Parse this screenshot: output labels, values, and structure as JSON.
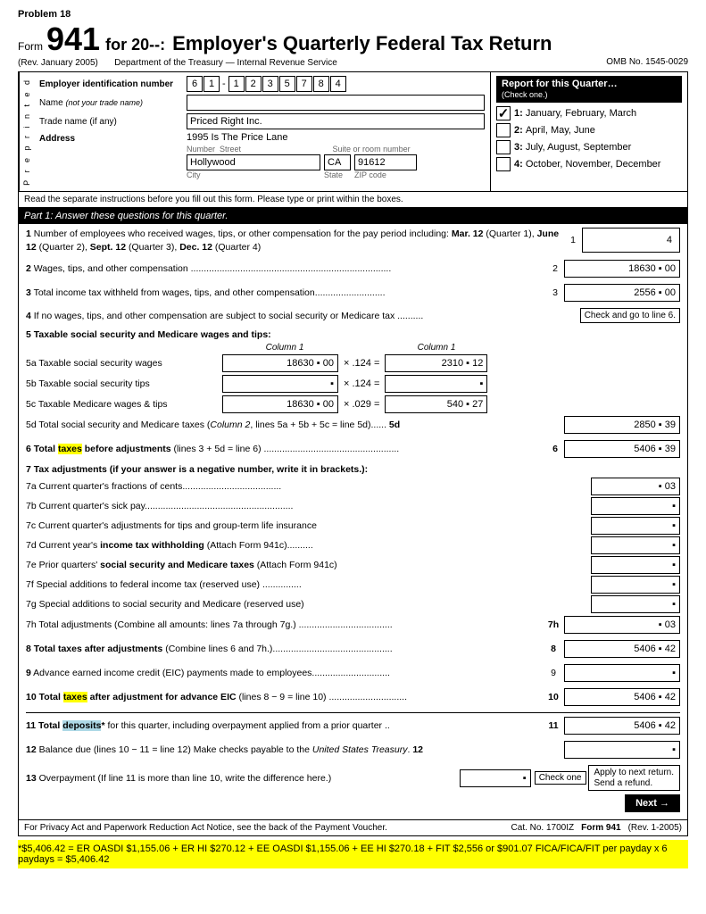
{
  "problem": {
    "label": "Problem 18"
  },
  "header": {
    "form_label": "Form",
    "form_number": "941",
    "for_text": "for 20--:",
    "title": "Employer's Quarterly Federal Tax Return",
    "rev": "(Rev. January 2005)",
    "dept": "Department of the Treasury — Internal Revenue Service",
    "omb": "OMB No. 1545-0029"
  },
  "employer": {
    "ein_label": "Employer identification number",
    "ein_digits": [
      "6",
      "1",
      "1",
      "2",
      "3",
      "5",
      "7",
      "8",
      "4"
    ],
    "name_label": "Name",
    "name_sublabel": "(not your trade name)",
    "name_value": "",
    "trade_label": "Trade name (if any)",
    "trade_value": "Priced Right Inc.",
    "address_label": "Address",
    "address_line1": "1995 Is The Price Lane",
    "number_label": "Number",
    "street_label": "Street",
    "suite_label": "Suite or room number",
    "city_value": "Hollywood",
    "state_value": "CA",
    "zip_value": "91612",
    "city_label": "City",
    "state_label": "State",
    "zip_label": "ZIP code"
  },
  "quarter": {
    "title": "Report for this Quarter…",
    "subtitle": "(Check one.)",
    "options": [
      {
        "num": "1",
        "label": "January, February, March",
        "checked": true
      },
      {
        "num": "2",
        "label": "April, May, June",
        "checked": false
      },
      {
        "num": "3",
        "label": "July, August, September",
        "checked": false
      },
      {
        "num": "4",
        "label": "October, November, December",
        "checked": false
      }
    ]
  },
  "preprinted": "P r e p r i n t e d",
  "instructions": "Read the separate instructions before you fill out this form. Please type or print within the boxes.",
  "part1": {
    "header": "Part 1: Answer these questions for this quarter.",
    "lines": [
      {
        "num": "1",
        "text": "Number of employees who received wages, tips, or other compensation for the pay period including: Mar. 12 (Quarter 1), June 12 (Quarter 2), Sept. 12 (Quarter 3), Dec. 12 (Quarter 4)",
        "value": "4"
      },
      {
        "num": "2",
        "text": "Wages, tips, and other compensation ............................................................................",
        "value": "18630 . 00"
      },
      {
        "num": "3",
        "text": "Total income tax withheld from wages, tips, and other compensation...........................",
        "value": "2556 . 00"
      }
    ],
    "line4": "4 If no wages, tips, and other compensation are subject to social security or Medicare tax ..........",
    "line4_check": "Check and go to line 6.",
    "line5_header": "5 Taxable social security and Medicare wages and tips:",
    "col1_label": "Column 1",
    "col2_label": "Column 1",
    "line5a_label": "5a Taxable social security wages",
    "line5a_col1": "18630 . 00",
    "line5a_op": "× .124 =",
    "line5a_col2": "2310 . 12",
    "line5b_label": "5b Taxable social security tips",
    "line5b_col1": "",
    "line5b_op": "× .124 =",
    "line5b_col2": "",
    "line5c_label": "5c Taxable Medicare wages & tips",
    "line5c_col1": "18630 . 00",
    "line5c_op": "× .029 =",
    "line5c_col2": "540 . 27",
    "line5d_text": "5d Total social security and Medicare taxes (Column 2, lines 5a + 5b + 5c = line 5d)...... 5d",
    "line5d_value": "2850 . 39",
    "line6_text": "6 Total taxes before adjustments (lines 3 + 5d = line 6) ....................................................",
    "line6_num": "6",
    "line6_value": "5406 . 39",
    "line7_header": "7 Tax adjustments (if your answer is a negative number, write it in brackets.):",
    "adj_lines": [
      {
        "id": "7a",
        "label": "7a Current quarter's fractions of cents......................................",
        "value": ". 03"
      },
      {
        "id": "7b",
        "label": "7b Current quarter's sick pay.......................................................",
        "value": "."
      },
      {
        "id": "7c",
        "label": "7c Current quarter's adjustments for tips and group-term life insurance",
        "value": "."
      },
      {
        "id": "7d",
        "label": "7d Current year's income tax withholding (Attach Form 941c)..........",
        "value": "."
      },
      {
        "id": "7e",
        "label": "7e Prior quarters' social security and Medicare taxes (Attach Form 941c)",
        "value": "."
      },
      {
        "id": "7f",
        "label": "7f Special additions to federal income tax (reserved use) ...............",
        "value": "."
      },
      {
        "id": "7g",
        "label": "7g Special additions to social security and Medicare (reserved use)",
        "value": "."
      }
    ],
    "line7h_text": "7h Total adjustments (Combine all amounts: lines 7a through 7g.) ....................................",
    "line7h_num": "7h",
    "line7h_value": ". 03",
    "line8_text": "8 Total taxes after adjustments (Combine lines 6 and 7h.)...............................................",
    "line8_num": "8",
    "line8_value": "5406 . 42",
    "line9_text": "9 Advance earned income credit (EIC) payments made to employees..............................",
    "line9_num": "9",
    "line9_value": ".",
    "line10_text": "10 Total taxes after adjustment for advance EIC (lines 8 − 9 = line 10) ..............................",
    "line10_num": "10",
    "line10_value": "5406 . 42",
    "line11_text": "11 Total deposits* for this quarter, including overpayment applied from a prior quarter ..",
    "line11_num": "11",
    "line11_value": "5406 . 42",
    "line12_text": "12 Balance due (lines 10 − 11 = line 12) Make checks payable to the United States Treasury.",
    "line12_num": "12",
    "line12_value": ".",
    "line13_text": "13 Overpayment (If line 11 is more than line 10, write the difference here.)",
    "line13_value": ".",
    "check_one": "Check one",
    "apply_next": "Apply to next return.",
    "send_refund": "Send a refund.",
    "next_btn": "Next →"
  },
  "footer": {
    "privacy_text": "For Privacy Act and Paperwork Reduction Act Notice, see the back of the Payment Voucher.",
    "cat": "Cat. No. 1700IZ",
    "form_footer": "Form 941",
    "rev_footer": "(Rev. 1-2005)"
  },
  "bottom_note": "*$5,406.42 = ER OASDI $1,155.06 + ER HI $270.12 + EE OASDI $1,155.06 + EE HI $270.18 + FIT $2,556 or $901.07 FICA/FICA/FIT per payday x 6 paydays = $5,406.42"
}
